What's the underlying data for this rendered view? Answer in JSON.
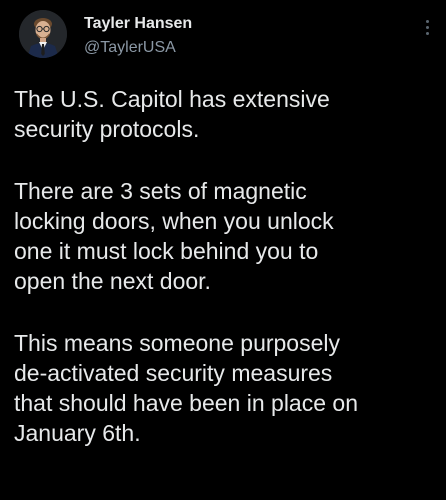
{
  "tweet": {
    "author": {
      "display_name": "Tayler Hansen",
      "handle": "@TaylerUSA"
    },
    "more_icon": "vertical-ellipsis",
    "paragraphs": [
      {
        "lines": [
          "The U.S. Capitol has extensive",
          "security protocols."
        ]
      },
      {
        "lines": [
          "There are 3 sets of magnetic",
          "locking doors, when you unlock",
          "one it must lock behind you to",
          "open the next door."
        ]
      },
      {
        "lines": [
          "This means someone purposely",
          "de-activated security measures",
          "that should have been in place on",
          "January 6th."
        ]
      }
    ]
  },
  "colors": {
    "background": "#000000",
    "text_primary": "#e7e9ea",
    "text_secondary": "#8b98a5"
  }
}
